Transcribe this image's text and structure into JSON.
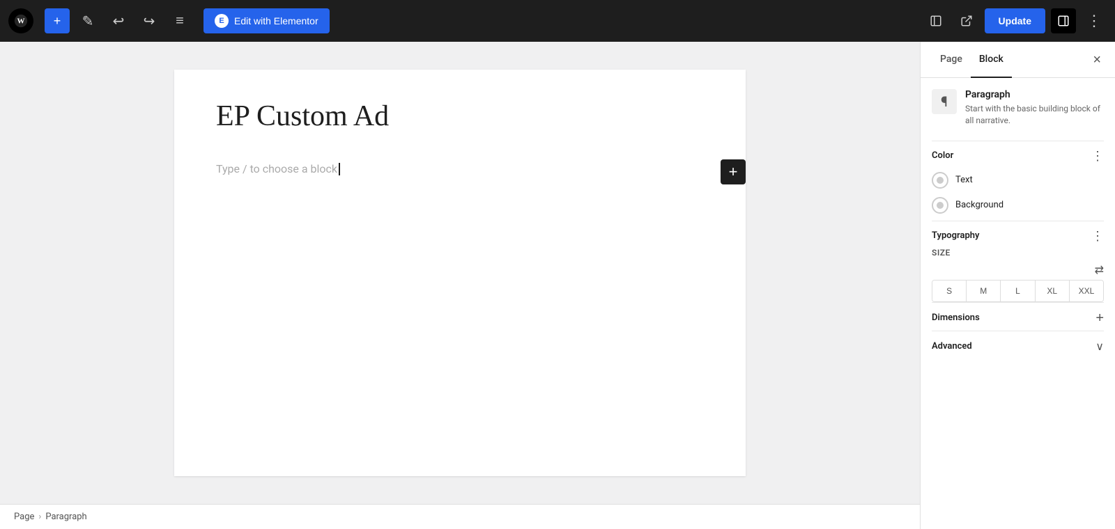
{
  "toolbar": {
    "add_label": "+",
    "pen_label": "✎",
    "undo_label": "↩",
    "redo_label": "↪",
    "list_label": "≡",
    "elementor_label": "Edit with Elementor",
    "elementor_icon_label": "E",
    "update_label": "Update",
    "view_label": "□",
    "external_label": "↗",
    "settings_label": "⋮",
    "sidebar_label": "▣"
  },
  "editor": {
    "page_title": "EP Custom Ad",
    "placeholder": "Type / to choose a block",
    "add_block_label": "+"
  },
  "breadcrumb": {
    "page_label": "Page",
    "separator": "›",
    "paragraph_label": "Paragraph"
  },
  "sidebar": {
    "page_tab": "Page",
    "block_tab": "Block",
    "close_label": "×",
    "block_info": {
      "name": "Paragraph",
      "description": "Start with the basic building block of all narrative."
    },
    "color_section": {
      "title": "Color",
      "more_label": "⋮",
      "text_label": "Text",
      "background_label": "Background"
    },
    "typography_section": {
      "title": "Typography",
      "more_label": "⋮",
      "size_label": "SIZE",
      "sizes": [
        "S",
        "M",
        "L",
        "XL",
        "XXL"
      ]
    },
    "dimensions_section": {
      "title": "Dimensions",
      "add_label": "+"
    },
    "advanced_section": {
      "title": "Advanced",
      "chevron_label": "∨"
    }
  }
}
